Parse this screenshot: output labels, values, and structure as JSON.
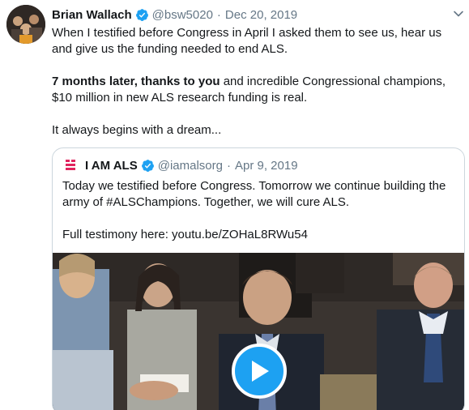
{
  "tweet": {
    "author_name": "Brian Wallach",
    "handle": "@bsw5020",
    "separator": "·",
    "date": "Dec 20, 2019",
    "paragraph1": "When I testified before Congress in April I asked them to see us, hear us and give us the funding needed to end ALS.",
    "paragraph2_bold": "7 months later, thanks to you",
    "paragraph2_rest": " and incredible Congressional champions, $10 million in new ALS research funding is real.",
    "paragraph3": "It always begins with a dream..."
  },
  "quoted_tweet": {
    "author_name": "I AM ALS",
    "handle": "@iamalsorg",
    "separator": "·",
    "date": "Apr 9, 2019",
    "paragraph1": "Today we testified before Congress. Tomorrow we continue building the army of #ALSChampions. Together, we will cure ALS.",
    "paragraph2": "Full testimony here: youtu.be/ZOHaL8RWu54",
    "avatar_logo_text": "I AM ALS"
  },
  "icons": {
    "verified": "verified-badge-icon",
    "more": "chevron-down-icon",
    "play": "play-icon"
  },
  "colors": {
    "accent": "#1da1f2",
    "text": "#14171a",
    "muted": "#657786",
    "border": "#ccd6dd"
  }
}
